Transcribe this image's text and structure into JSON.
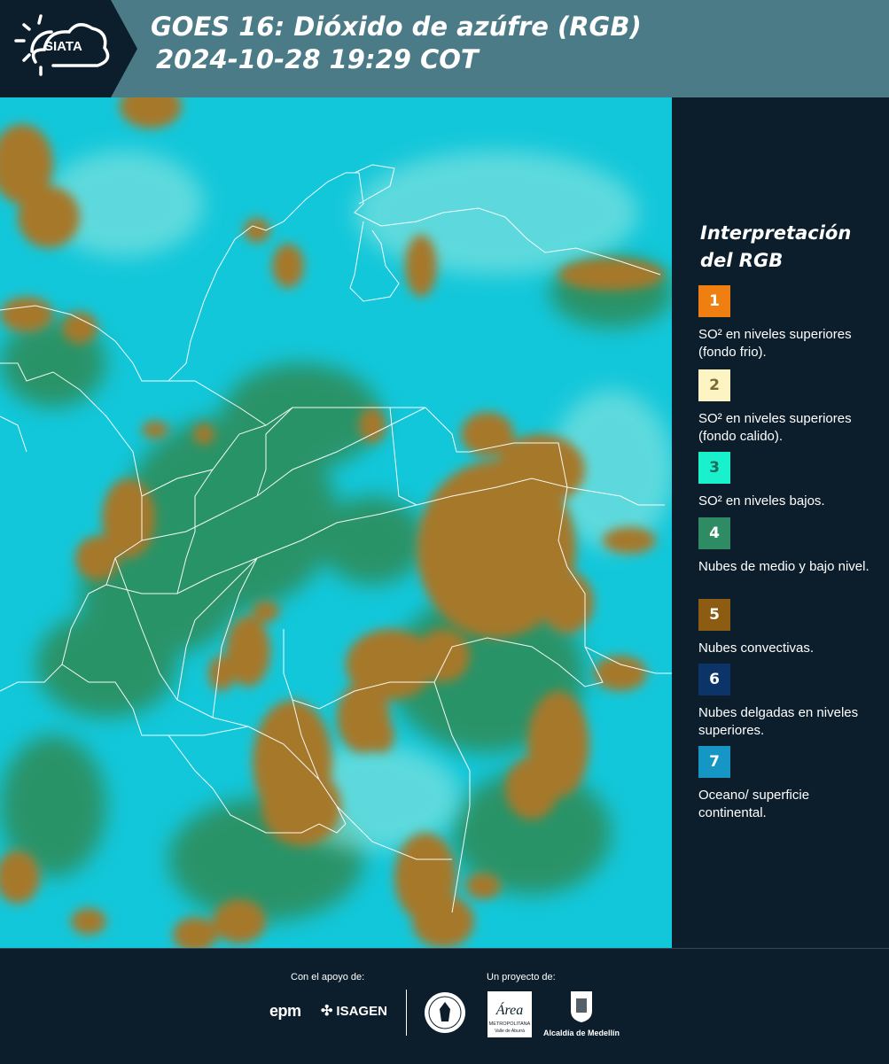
{
  "header": {
    "logo_text": "SIATA",
    "title_line1": "GOES 16: Dióxido de azúfre (RGB)",
    "title_line2": "2024-10-28 19:29 COT"
  },
  "legend": {
    "title_line1": "Interpretación",
    "title_line2": "del RGB",
    "items": [
      {
        "number": "1",
        "color": "#f07f11",
        "text_color": "#ffffff",
        "label": "SO² en niveles superiores (fondo frio)."
      },
      {
        "number": "2",
        "color": "#fcf4c2",
        "text_color": "#7a6a30",
        "label": "SO² en niveles superiores (fondo calido)."
      },
      {
        "number": "3",
        "color": "#19f1cd",
        "text_color": "#1a6b5c",
        "label": "SO² en niveles bajos."
      },
      {
        "number": "4",
        "color": "#2f8b63",
        "text_color": "#ffffff",
        "label": "Nubes de medio y bajo nivel."
      },
      {
        "number": "5",
        "color": "#8c5c12",
        "text_color": "#ffffff",
        "label": "Nubes convectivas."
      },
      {
        "number": "6",
        "color": "#0c3469",
        "text_color": "#ffffff",
        "label": "Nubes delgadas en niveles superiores."
      },
      {
        "number": "7",
        "color": "#1596c4",
        "text_color": "#ffffff",
        "label": "Oceano/ superficie continental."
      }
    ]
  },
  "footer": {
    "support_label": "Con el apoyo de:",
    "project_label": "Un proyecto de:",
    "epm": "epm",
    "isagen": "ISAGEN",
    "area_line1": "Área",
    "area_line2": "METROPOLITANA",
    "area_line3": "Valle de Aburrá",
    "alcaldia": "Alcaldía de Medellín"
  },
  "map": {
    "ocean_color": "#12c6d8",
    "cloud_color": "#a07a28",
    "green_cloud_color": "#2f8b55",
    "border_color": "#ffffff"
  }
}
